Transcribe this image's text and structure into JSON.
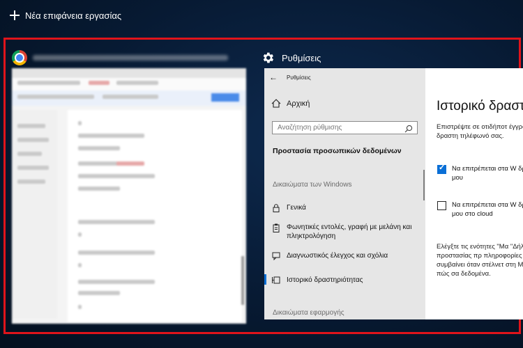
{
  "top_bar": {
    "new_desktop_label": "Νέα επιφάνεια εργασίας"
  },
  "chrome_window": {
    "icon": "chrome-icon"
  },
  "settings_window": {
    "title": "Ρυθμίσεις",
    "header_title": "Ρυθμίσεις",
    "home_label": "Αρχική",
    "search_placeholder": "Αναζήτηση ρύθμισης",
    "privacy_heading": "Προστασία προσωπικών δεδομένων",
    "windows_permissions_section": "Δικαιώματα των Windows",
    "nav_items": [
      {
        "label": "Γενικά",
        "icon": "lock-icon"
      },
      {
        "label": "Φωνητικές εντολές, γραφή με μελάνη και πληκτρολόγηση",
        "icon": "clipboard-icon"
      },
      {
        "label": "Διαγνωστικός έλεγχος και σχόλια",
        "icon": "feedback-icon"
      },
      {
        "label": "Ιστορικό δραστηριότητας",
        "icon": "timeline-icon",
        "active": true
      }
    ],
    "app_permissions_section": "Δικαιώματα εφαρμογής",
    "page_title": "Ιστορικό δραστ",
    "intro_text": "Επιστρέψτε σε οτιδήποτ έγγραφα ή άλλες δραστη τηλέφωνό σας.",
    "checkbox1": {
      "label": "Να επιτρέπεται στα W δραστηριότητές μου",
      "checked": true
    },
    "checkbox2": {
      "label": "Να επιτρέπεται στα W δραστηριότητές μου στο cloud",
      "checked": false
    },
    "privacy_text": "Ελέγξτε τις ενότητες \"Μα \"Δήλωση προστασίας πρ πληροφορίες σχετικά με συμβαίνει όταν στέλνετ στη Microsoft και πώς σα δεδομένα."
  }
}
